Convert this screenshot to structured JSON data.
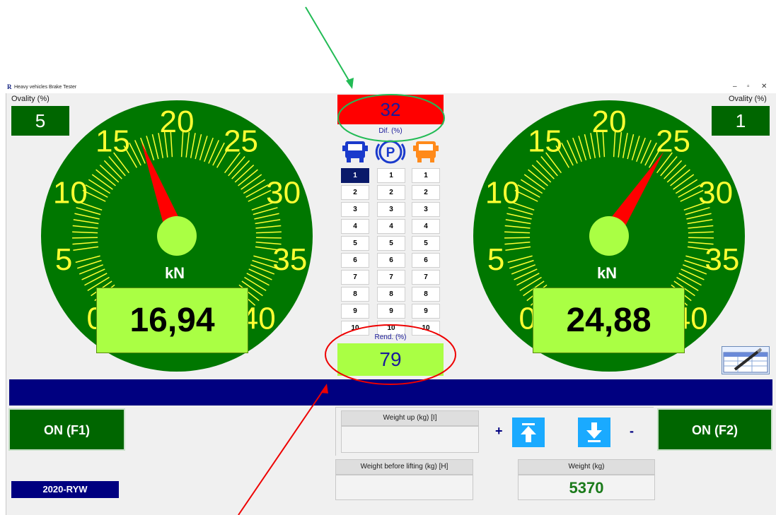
{
  "window": {
    "title": "Heavy vehicles Brake Tester",
    "app_icon_letter": "R",
    "controls": [
      "–",
      "▫",
      "✕"
    ]
  },
  "left": {
    "ovality_label": "Ovality (%)",
    "ovality_value": "5",
    "unit": "kN",
    "reading": "16,94",
    "needle_value": 16.94
  },
  "right": {
    "ovality_label": "Ovality (%)",
    "ovality_value": "1",
    "unit": "kN",
    "reading": "24,88",
    "needle_value": 24.88
  },
  "gauge": {
    "min": 0,
    "max": 40,
    "labels": [
      "0",
      "5",
      "10",
      "15",
      "20",
      "25",
      "30",
      "35",
      "40"
    ],
    "face_color": "#007700",
    "label_color": "#ffff33",
    "needle_color": "#ff0000",
    "hub_color": "#aaff44"
  },
  "center": {
    "dif_value": "32",
    "dif_label": "Dif. (%)",
    "rend_label": "Rend. (%)",
    "rend_value": "79",
    "icons": [
      "truck-front-blue",
      "parking-brake",
      "truck-front-orange"
    ],
    "axles": [
      "1",
      "2",
      "3",
      "4",
      "5",
      "6",
      "7",
      "8",
      "9",
      "10"
    ],
    "selected_axle": "1"
  },
  "buttons": {
    "left_on": "ON (F1)",
    "right_on": "ON (F2)",
    "plus": "+",
    "minus": "-"
  },
  "fields": {
    "weight_up_label": "Weight up (kg) [I]",
    "weight_up_value": "",
    "weight_before_label": "Weight before lifting (kg) [H]",
    "weight_before_value": "",
    "weight_label": "Weight (kg)",
    "weight_value": "5370"
  },
  "plate": "2020-RYW",
  "annotations": {
    "green_arrow_color": "#22bb55",
    "red_arrow_color": "#ee0000"
  }
}
